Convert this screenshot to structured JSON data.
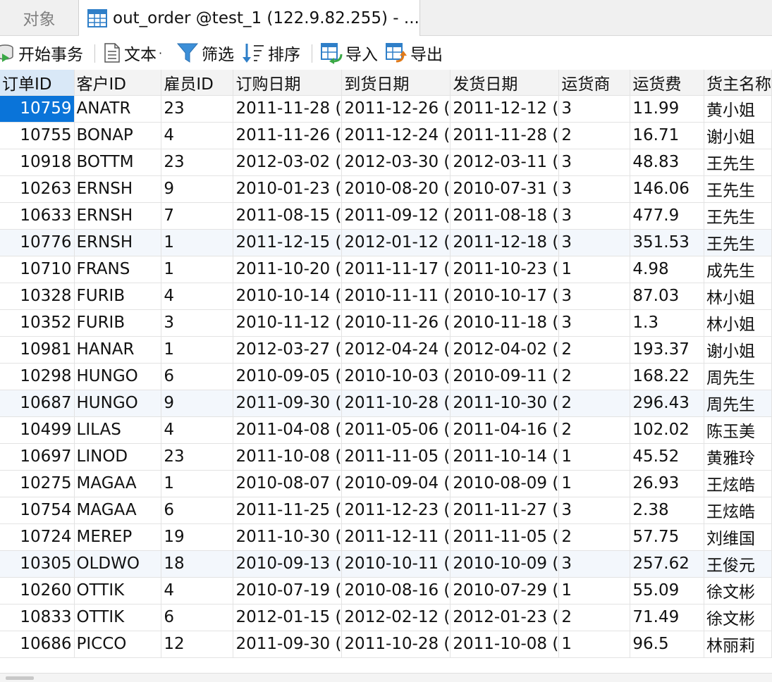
{
  "tabs": {
    "objects": "对象",
    "active": "out_order @test_1 (122.9.82.255) - ..."
  },
  "toolbar": {
    "begin_transaction": "开始事务",
    "text": "文本",
    "text_caret": "·",
    "filter": "筛选",
    "sort": "排序",
    "import": "导入",
    "export": "导出"
  },
  "columns": [
    "订单ID",
    "客户ID",
    "雇员ID",
    "订购日期",
    "到货日期",
    "发货日期",
    "运货商",
    "运货费",
    "货主名称"
  ],
  "rows": [
    [
      "10759",
      "ANATR",
      "23",
      "2011-11-28 (",
      "2011-12-26 (",
      "2011-12-12 (",
      "3",
      "11.99",
      "黄小姐"
    ],
    [
      "10755",
      "BONAP",
      "4",
      "2011-11-26 (",
      "2011-12-24 (",
      "2011-11-28 (",
      "2",
      "16.71",
      "谢小姐"
    ],
    [
      "10918",
      "BOTTM",
      "23",
      "2012-03-02 (",
      "2012-03-30 (",
      "2012-03-11 (",
      "3",
      "48.83",
      "王先生"
    ],
    [
      "10263",
      "ERNSH",
      "9",
      "2010-01-23 (",
      "2010-08-20 (",
      "2010-07-31 (",
      "3",
      "146.06",
      "王先生"
    ],
    [
      "10633",
      "ERNSH",
      "7",
      "2011-08-15 (",
      "2011-09-12 (",
      "2011-08-18 (",
      "3",
      "477.9",
      "王先生"
    ],
    [
      "10776",
      "ERNSH",
      "1",
      "2011-12-15 (",
      "2012-01-12 (",
      "2011-12-18 (",
      "3",
      "351.53",
      "王先生"
    ],
    [
      "10710",
      "FRANS",
      "1",
      "2011-10-20 (",
      "2011-11-17 (",
      "2011-10-23 (",
      "1",
      "4.98",
      "成先生"
    ],
    [
      "10328",
      "FURIB",
      "4",
      "2010-10-14 (",
      "2010-11-11 (",
      "2010-10-17 (",
      "3",
      "87.03",
      "林小姐"
    ],
    [
      "10352",
      "FURIB",
      "3",
      "2010-11-12 (",
      "2010-11-26 (",
      "2010-11-18 (",
      "3",
      "1.3",
      "林小姐"
    ],
    [
      "10981",
      "HANAR",
      "1",
      "2012-03-27 (",
      "2012-04-24 (",
      "2012-04-02 (",
      "2",
      "193.37",
      "谢小姐"
    ],
    [
      "10298",
      "HUNGO",
      "6",
      "2010-09-05 (",
      "2010-10-03 (",
      "2010-09-11 (",
      "2",
      "168.22",
      "周先生"
    ],
    [
      "10687",
      "HUNGO",
      "9",
      "2011-09-30 (",
      "2011-10-28 (",
      "2011-10-30 (",
      "2",
      "296.43",
      "周先生"
    ],
    [
      "10499",
      "LILAS",
      "4",
      "2011-04-08 (",
      "2011-05-06 (",
      "2011-04-16 (",
      "2",
      "102.02",
      "陈玉美"
    ],
    [
      "10697",
      "LINOD",
      "23",
      "2011-10-08 (",
      "2011-11-05 (",
      "2011-10-14 (",
      "1",
      "45.52",
      "黄雅玲"
    ],
    [
      "10275",
      "MAGAA",
      "1",
      "2010-08-07 (",
      "2010-09-04 (",
      "2010-08-09 (",
      "1",
      "26.93",
      "王炫皓"
    ],
    [
      "10754",
      "MAGAA",
      "6",
      "2011-11-25 (",
      "2011-12-23 (",
      "2011-11-27 (",
      "3",
      "2.38",
      "王炫皓"
    ],
    [
      "10724",
      "MEREP",
      "19",
      "2011-10-30 (",
      "2011-12-11 (",
      "2011-11-05 (",
      "2",
      "57.75",
      "刘维国"
    ],
    [
      "10305",
      "OLDWO",
      "18",
      "2010-09-13 (",
      "2010-10-11 (",
      "2010-10-09 (",
      "3",
      "257.62",
      "王俊元"
    ],
    [
      "10260",
      "OTTIK",
      "4",
      "2010-07-19 (",
      "2010-08-16 (",
      "2010-07-29 (",
      "1",
      "55.09",
      "徐文彬"
    ],
    [
      "10833",
      "OTTIK",
      "6",
      "2012-01-15 (",
      "2012-02-12 (",
      "2012-01-23 (",
      "2",
      "71.49",
      "徐文彬"
    ],
    [
      "10686",
      "PICCO",
      "12",
      "2011-09-30 (",
      "2011-10-28 (",
      "2011-10-08 (",
      "1",
      "96.5",
      "林丽莉"
    ]
  ],
  "colors": {
    "selection": "#0a74d9",
    "header_bg": "#f3f3f3",
    "alt_row_bg": "#f3f7fc",
    "filter_icon": "#3c8fd8",
    "import_export_icon": "#2f7fc8"
  }
}
